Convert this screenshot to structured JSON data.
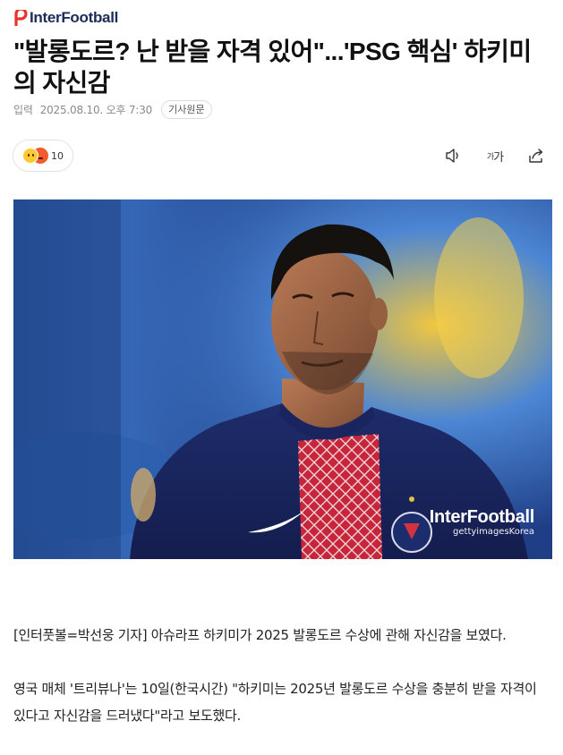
{
  "brand": {
    "name": "InterFootball",
    "color": "#1e2b57",
    "mark_color": "#e8332a"
  },
  "article": {
    "headline": "\"발롱도르? 난 받을 자격 있어\"...'PSG 핵심' 하키미의 자신감",
    "meta_label": "입력",
    "date": "2025.08.10. 오후 7:30",
    "source_label": "기사원문"
  },
  "reactions": {
    "count": "10",
    "emojis": [
      "smile-emoji",
      "angry-emoji"
    ]
  },
  "toolbar": {
    "icons": [
      "speaker-icon",
      "font-size-icon",
      "share-icon"
    ],
    "font_size_label": "가"
  },
  "photo": {
    "watermark_title": "InterFootball",
    "watermark_sub": "gettyimagesKorea"
  },
  "body": {
    "paragraphs": [
      "[인터풋볼=박선웅 기자] 아슈라프 하키미가 2025 발롱도르 수상에 관해 자신감을 보였다.",
      "영국 매체 '트리뷰나'는 10일(한국시간) \"하키미는 2025년 발롱도르 수상을 충분히 받을 자격이 있다고 자신감을 드러냈다\"라고 보도했다."
    ]
  }
}
